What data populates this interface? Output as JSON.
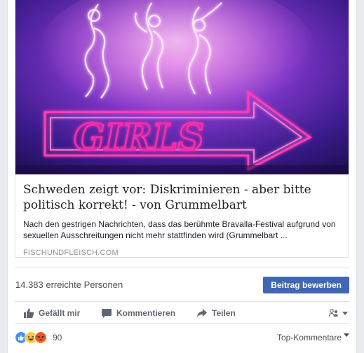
{
  "link": {
    "title": "Schweden zeigt vor: Diskriminieren - aber bitte politisch korrekt! - von Grummelbart",
    "description": "Nach den gestrigen Nachrichten, dass das berühmte Bravalla-Festival aufgrund von sexuellen Ausschreitungen nicht mehr stattfinden wird (Grummelbart ...",
    "domain": "FISCHUNDFLEISCH.COM",
    "image_sign_text": "GIRLS"
  },
  "reach": {
    "text": "14.383 erreichte Personen",
    "boost_label": "Beitrag bewerben"
  },
  "actions": {
    "like_label": "Gefällt mir",
    "comment_label": "Kommentieren",
    "share_label": "Teilen"
  },
  "reactions": {
    "count": "90",
    "icons": [
      "like-icon",
      "haha-icon",
      "angry-icon"
    ],
    "sort_label": "Top-Kommentare"
  },
  "colors": {
    "accent": "#4267b2",
    "link_blue": "#385898",
    "neon_pink": "#ff2fa8",
    "neon_bg": "#7a2fb8"
  }
}
